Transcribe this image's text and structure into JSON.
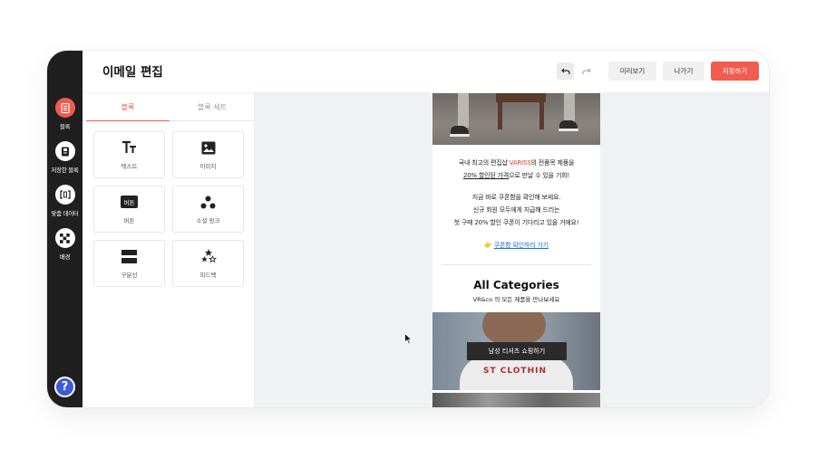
{
  "header": {
    "title": "이메일 편집",
    "preview_label": "미리보기",
    "exit_label": "나가기",
    "save_label": "저장하기",
    "accent_color": "#f25b50"
  },
  "rail": {
    "items": [
      {
        "label": "블록",
        "icon": "block-icon"
      },
      {
        "label": "저장한 블록",
        "icon": "saved-block-icon"
      },
      {
        "label": "맞춤 데이터",
        "icon": "custom-data-icon"
      },
      {
        "label": "배경",
        "icon": "background-icon"
      }
    ],
    "help_label": "?"
  },
  "panel": {
    "tabs": [
      {
        "label": "블록",
        "active": true
      },
      {
        "label": "블록 세트",
        "active": false
      }
    ],
    "tiles": [
      {
        "label": "텍스트",
        "icon": "text-icon"
      },
      {
        "label": "이미지",
        "icon": "image-icon"
      },
      {
        "label": "버튼",
        "icon": "button-icon",
        "icon_text": "버튼"
      },
      {
        "label": "소셜 링크",
        "icon": "social-link-icon"
      },
      {
        "label": "구분선",
        "icon": "divider-icon"
      },
      {
        "label": "피드백",
        "icon": "feedback-icon"
      }
    ]
  },
  "email": {
    "line1_pre": "국내 최고의 편집샵 ",
    "line1_brand": "VARISS",
    "line1_post": "의 전품목 제품을",
    "line2_underlined": "20% 할인된 가격",
    "line2_post": "으로 만날 수 있을 기회!",
    "line3": "지금 바로 쿠폰함을 확인해 보세요.",
    "line4": "신규 회원 모두에게 지급해 드리는",
    "line5": "첫 구매 20% 할인 쿠폰이 기다리고 있을 거에요!",
    "link_emoji": "👉",
    "link_text": "쿠폰함 확인하러 가기",
    "category_title": "All Categories",
    "category_sub": "VR&co 의 모든 제품을 만나보세요",
    "shirt_button": "남성 티셔츠 쇼핑하기",
    "shirt_print": "ST CLOTHIN"
  }
}
